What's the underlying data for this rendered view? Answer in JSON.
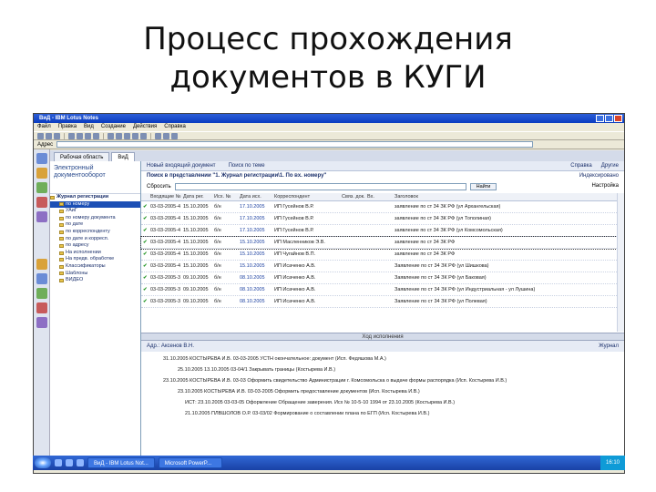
{
  "slide": {
    "title_line1": "Процесс прохождения",
    "title_line2": "документов в КУГИ"
  },
  "window": {
    "title": "ВиД - IBM Lotus Notes",
    "menu": [
      "Файл",
      "Правка",
      "Вид",
      "Создание",
      "Действия",
      "Справка"
    ],
    "address_label": "Адрес"
  },
  "tabs": [
    {
      "label": "Рабочая область"
    },
    {
      "label": "ВиД"
    }
  ],
  "nav": {
    "header": "Электронный документооборот",
    "root": "Журнал регистрации",
    "items": [
      {
        "label": "по номеру",
        "selected": true
      },
      {
        "label": "УАиГ"
      },
      {
        "label": "по номеру документа"
      },
      {
        "label": "по дате"
      },
      {
        "label": "по корреспонденту"
      },
      {
        "label": "по дате и корресп."
      },
      {
        "label": "по адресу"
      },
      {
        "label": "На исполнении"
      },
      {
        "label": "На предв. обработке"
      },
      {
        "label": "Классификаторы"
      },
      {
        "label": "Шаблоны"
      },
      {
        "label": "ВИДЕО"
      }
    ]
  },
  "main": {
    "actions": [
      "Новый входящий документ",
      "Поиск по теме"
    ],
    "actions_right": [
      "Справка",
      "Другие"
    ],
    "view_title": "Поиск в представлении \"1. Журнал регистрации\\1. По вх. номеру\"",
    "view_title_right": "Индексировано",
    "search_label": "Сбросить",
    "search_button": "Найти",
    "search_right": "Настройка",
    "columns": [
      "",
      "Входящие №",
      "Дата рег.",
      "Исх. №",
      "Дата исх.",
      "Корреспондент",
      "Связ. док.",
      "Вх.",
      "Заголовок"
    ],
    "rows": [
      {
        "num": "03-03-2005-4",
        "date": "15.10.2005",
        "out": "б/н",
        "odate": "17.10.2005",
        "corr": "ИП Гусейнов В.Р.",
        "title": "заявление по ст 34 ЗК РФ (ул Архангельская)"
      },
      {
        "num": "03-03-2005-4",
        "date": "15.10.2005",
        "out": "б/н",
        "odate": "17.10.2005",
        "corr": "ИП Гусейнов В.Р.",
        "title": "заявление по ст 34 ЗК РФ (ул Тополиная)"
      },
      {
        "num": "03-03-2005-4",
        "date": "15.10.2005",
        "out": "б/н",
        "odate": "17.10.2005",
        "corr": "ИП Гусейнов В.Р.",
        "title": "заявление по ст 34 ЗК РФ (ул Комсомольская)"
      },
      {
        "num": "03-03-2005-4",
        "date": "15.10.2005",
        "out": "б/н",
        "odate": "15.10.2005",
        "corr": "ИП Масленников Э.В.",
        "title": "заявление по ст 34 ЗК РФ",
        "selected": true
      },
      {
        "num": "03-03-2005-4",
        "date": "15.10.2005",
        "out": "б/н",
        "odate": "15.10.2005",
        "corr": "ИП Чугайнов В.П.",
        "title": "заявление по ст 34 ЗК РФ"
      },
      {
        "num": "03-03-2005-4",
        "date": "15.10.2005",
        "out": "б/н",
        "odate": "15.10.2005",
        "corr": "ИП Исаченко А.В.",
        "title": "Заявление по ст 34 ЗК РФ (ул Шишкова)"
      },
      {
        "num": "03-03-2005-3",
        "date": "09.10.2005",
        "out": "б/н",
        "odate": "08.10.2005",
        "corr": "ИП Исаченко А.В.",
        "title": "Заявление по ст 34 ЗК РФ (ул Баковая)"
      },
      {
        "num": "03-03-2005-3",
        "date": "09.10.2005",
        "out": "б/н",
        "odate": "08.10.2005",
        "corr": "ИП Исаченко А.В.",
        "title": "Заявление по ст 34 ЗК РФ (ул Индустриальная - ул Лушина)"
      },
      {
        "num": "03-03-2005-3",
        "date": "09.10.2005",
        "out": "б/н",
        "odate": "08.10.2005",
        "corr": "ИП Исаченко А.В.",
        "title": "Заявление по ст 34 ЗК РФ (ул Полевая)"
      }
    ],
    "divider": "Ход исполнения",
    "preview_title": "Адр.: Аксенов В.Н.",
    "preview_right": "Журнал",
    "tree": [
      "31.10.2005 КОСТЫРЕВА И.В. 03-03-2005 УСТН окончательное: документ (Исп. Федяшова М.А.)",
      "25.10.2005 13.10.2005 03-04/1 Закрывать границы (Костырева И.В.)",
      "23.10.2005 КОСТЫРЕВА И.В. 03-03 Оформить свидетельство Администрации г. Комсомольска о выдаче формы распорядка (Исп. Костырева И.В.)",
      "23.10.2005 КОСТЫРЕВА И.В. 03-03-2005 Оформить предоставление документов (Исп. Костырева И.В.)",
      "ИСТ: 23.10.2005 03-03-05 Оформление Обращение заверения. Исх № 10-5-10 1994 от 23.10.2005 (Костырева И.В.)",
      "21.10.2005 ПЛВШОЛОВ О.Р. 03-03/02 Формирование о составлении плана по ЕГП (Исп. Костырева И.В.)"
    ]
  },
  "taskbar": {
    "tasks": [
      "ВиД - IBM Lotus Not...",
      "Microsoft PowerP..."
    ],
    "tray": "16:10"
  },
  "colors": {
    "accent": "#1c4fb5",
    "title_blue": "#0a3cc0",
    "check_green": "#2c9a2c"
  }
}
